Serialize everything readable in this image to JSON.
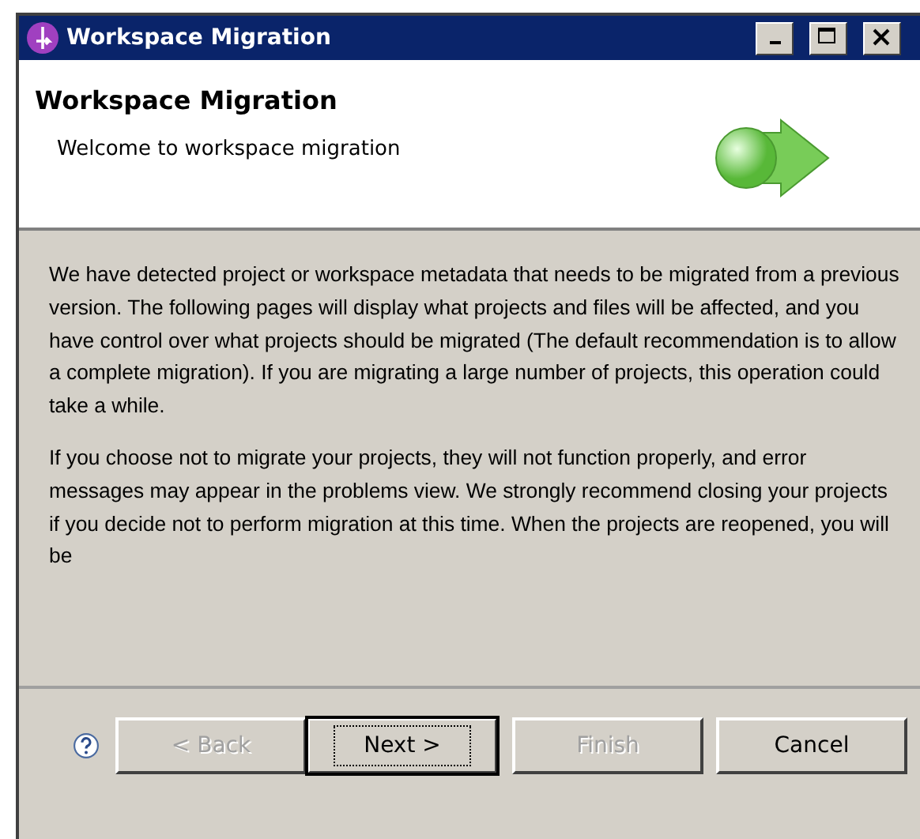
{
  "window": {
    "title": "Workspace Migration"
  },
  "header": {
    "title": "Workspace Migration",
    "subtitle": "Welcome to workspace migration"
  },
  "body": {
    "paragraphs": [
      "We have detected project or workspace metadata that needs to be migrated from a previous version. The following pages will display what projects and files will be affected, and you have control over what projects should be migrated (The default recommendation is to allow a complete migration). If you are migrating a large number of projects, this operation could take a while.",
      "If you choose not to migrate your projects, they will not function properly, and  error messages may appear in the problems view. We strongly recommend closing your projects if you decide not to perform migration at this time. When the projects are reopened, you will be"
    ]
  },
  "buttons": [
    {
      "label": "< Back",
      "disabled": true,
      "default": false
    },
    {
      "label": "Next >",
      "disabled": false,
      "default": true
    },
    {
      "label": "Finish",
      "disabled": true,
      "default": false
    },
    {
      "label": "Cancel",
      "disabled": false,
      "default": false
    }
  ]
}
